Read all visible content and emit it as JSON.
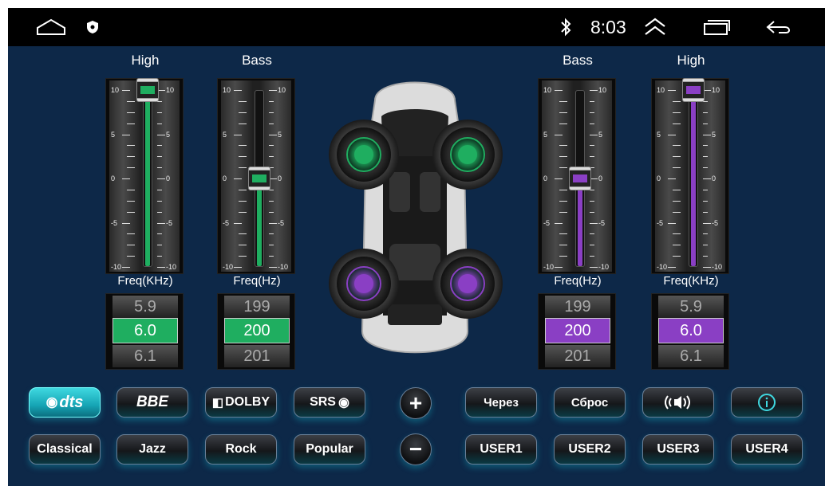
{
  "status_bar": {
    "home_icon": "home-outline-icon",
    "shield_icon": "shield-icon",
    "bluetooth_icon": "bluetooth-icon",
    "time": "8:03",
    "expand_icon": "double-chevron-up-icon",
    "recents_icon": "recent-apps-icon",
    "back_icon": "back-arrow-icon"
  },
  "colors": {
    "background": "#0d2848",
    "green_accent": "#1fae60",
    "purple_accent": "#8a3fc4",
    "active_button": "#20b8c8"
  },
  "left_sliders": [
    {
      "label": "High",
      "freq_label": "Freq(KHz)",
      "level": 10,
      "color": "green",
      "picker": {
        "prev": "5.9",
        "selected": "6.0",
        "next": "6.1"
      }
    },
    {
      "label": "Bass",
      "freq_label": "Freq(Hz)",
      "level": 0,
      "color": "green",
      "picker": {
        "prev": "199",
        "selected": "200",
        "next": "201"
      }
    }
  ],
  "right_sliders": [
    {
      "label": "Bass",
      "freq_label": "Freq(Hz)",
      "level": 0,
      "color": "purple",
      "picker": {
        "prev": "199",
        "selected": "200",
        "next": "201"
      }
    },
    {
      "label": "High",
      "freq_label": "Freq(KHz)",
      "level": 10,
      "color": "purple",
      "picker": {
        "prev": "5.9",
        "selected": "6.0",
        "next": "6.1"
      }
    }
  ],
  "scale_labels": [
    "10",
    "5",
    "0",
    "-5",
    "-10"
  ],
  "speakers": [
    {
      "name": "front-left",
      "color": "green"
    },
    {
      "name": "front-right",
      "color": "green"
    },
    {
      "name": "rear-left",
      "color": "purple"
    },
    {
      "name": "rear-right",
      "color": "purple"
    }
  ],
  "effects": {
    "dts_label": "dts",
    "bbe_label": "BBE",
    "dolby_label": "DOLBY",
    "srs_label": "SRS",
    "plus": "+",
    "minus": "−"
  },
  "actions": {
    "via_label": "Через",
    "reset_label": "Сброс",
    "surround_icon": "surround-sound-icon",
    "info_icon": "info-icon"
  },
  "presets": [
    "Classical",
    "Jazz",
    "Rock",
    "Popular"
  ],
  "user_presets": [
    "USER1",
    "USER2",
    "USER3",
    "USER4"
  ]
}
